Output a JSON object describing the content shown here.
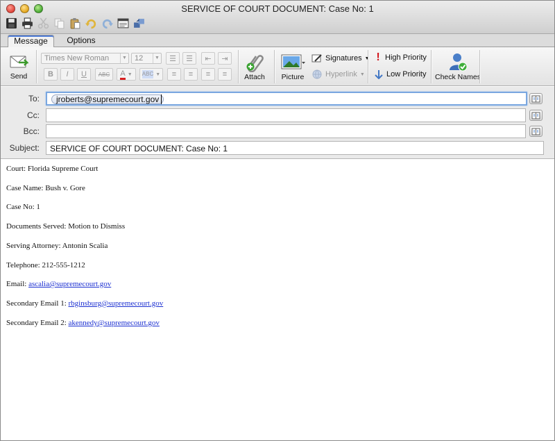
{
  "window": {
    "title": "SERVICE OF COURT DOCUMENT: Case No: 1"
  },
  "quick_toolbar": [
    {
      "icon": "save-icon"
    },
    {
      "icon": "print-icon"
    },
    {
      "icon": "cut-icon"
    },
    {
      "icon": "copy-icon"
    },
    {
      "icon": "paste-icon"
    },
    {
      "icon": "undo-icon"
    },
    {
      "icon": "redo-icon"
    },
    {
      "icon": "window-icon"
    },
    {
      "icon": "send-receive-icon"
    }
  ],
  "tabs": {
    "message": "Message",
    "options": "Options"
  },
  "ribbon": {
    "send": "Send",
    "font_name": "Times New Roman",
    "font_size": "12",
    "attach": "Attach",
    "picture": "Picture",
    "signatures": "Signatures",
    "hyperlink": "Hyperlink",
    "high_priority": "High Priority",
    "low_priority": "Low Priority",
    "check_names": "Check Names"
  },
  "header": {
    "to_label": "To:",
    "to_recipient": "jroberts@supremecourt.gov",
    "cc_label": "Cc:",
    "bcc_label": "Bcc:",
    "subject_label": "Subject:",
    "subject_value": "SERVICE OF COURT DOCUMENT: Case No: 1"
  },
  "body": {
    "court": "Court: Florida Supreme Court",
    "case_name": "Case Name: Bush v. Gore",
    "case_no": "Case No: 1",
    "documents": "Documents Served: Motion to Dismiss",
    "attorney": "Serving Attorney: Antonin Scalia",
    "telephone": "Telephone: 212-555-1212",
    "email_label": "Email: ",
    "email": "ascalia@supremecourt.gov",
    "email2_label": "Secondary Email 1: ",
    "email2": "rbginsburg@supremecourt.gov",
    "email3_label": "Secondary Email 2: ",
    "email3": "akennedy@supremecourt.gov"
  },
  "colors": {
    "link": "#1b2fd1",
    "focus": "#7aa7e0",
    "tab_accent": "#4d7bd6"
  }
}
